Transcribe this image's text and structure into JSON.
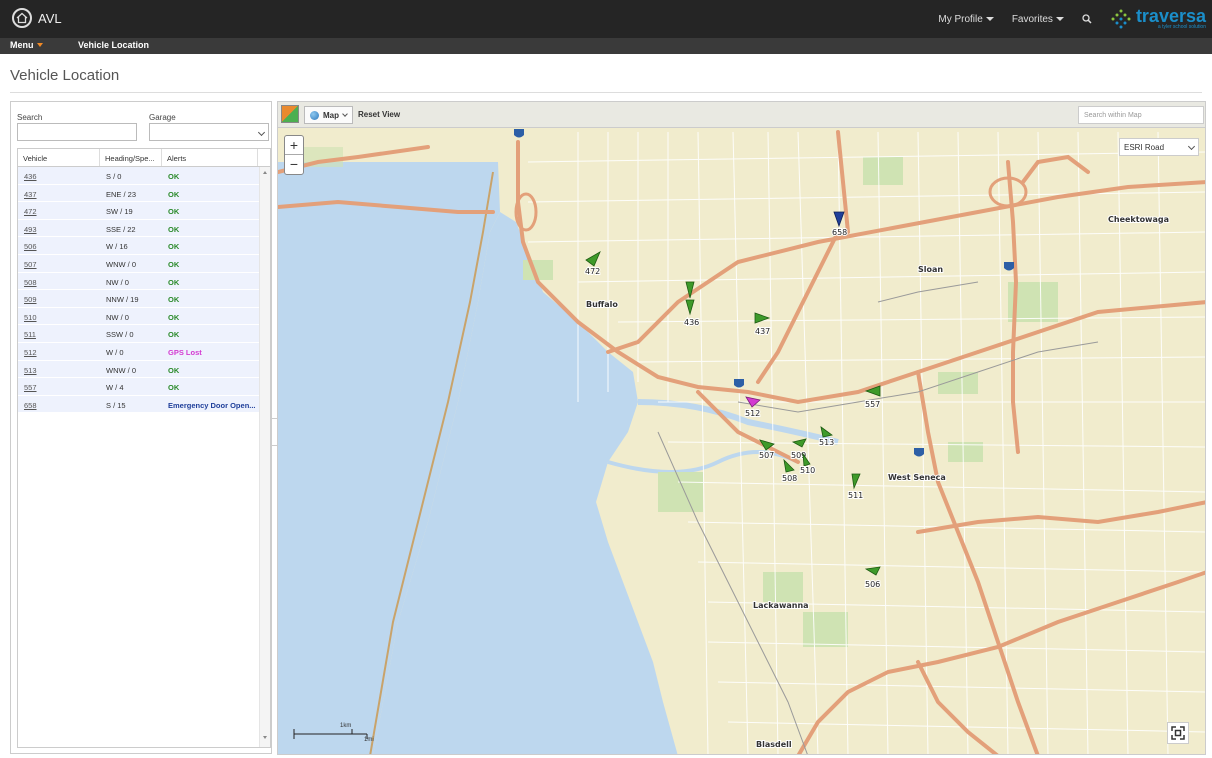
{
  "app": {
    "title": "AVL",
    "profile_label": "My Profile",
    "favorites_label": "Favorites",
    "brand_name": "traversa",
    "brand_sub": "a tyler school solution"
  },
  "nav": {
    "menu_label": "Menu",
    "breadcrumb": "Vehicle Location"
  },
  "page": {
    "title": "Vehicle Location"
  },
  "filters": {
    "search_label": "Search",
    "search_value": "",
    "garage_label": "Garage",
    "garage_value": ""
  },
  "table": {
    "columns": [
      "Vehicle",
      "Heading/Spe...",
      "Alerts"
    ],
    "rows": [
      {
        "vehicle": "436",
        "heading": "S / 0",
        "alert": "OK",
        "status": "ok"
      },
      {
        "vehicle": "437",
        "heading": "ENE / 23",
        "alert": "OK",
        "status": "ok"
      },
      {
        "vehicle": "472",
        "heading": "SW / 19",
        "alert": "OK",
        "status": "ok"
      },
      {
        "vehicle": "493",
        "heading": "SSE / 22",
        "alert": "OK",
        "status": "ok"
      },
      {
        "vehicle": "506",
        "heading": "W / 16",
        "alert": "OK",
        "status": "ok"
      },
      {
        "vehicle": "507",
        "heading": "WNW / 0",
        "alert": "OK",
        "status": "ok"
      },
      {
        "vehicle": "508",
        "heading": "NW / 0",
        "alert": "OK",
        "status": "ok"
      },
      {
        "vehicle": "509",
        "heading": "NNW / 19",
        "alert": "OK",
        "status": "ok"
      },
      {
        "vehicle": "510",
        "heading": "NW / 0",
        "alert": "OK",
        "status": "ok"
      },
      {
        "vehicle": "511",
        "heading": "SSW / 0",
        "alert": "OK",
        "status": "ok"
      },
      {
        "vehicle": "512",
        "heading": "W / 0",
        "alert": "GPS Lost",
        "status": "gps"
      },
      {
        "vehicle": "513",
        "heading": "WNW / 0",
        "alert": "OK",
        "status": "ok"
      },
      {
        "vehicle": "557",
        "heading": "W / 4",
        "alert": "OK",
        "status": "ok"
      },
      {
        "vehicle": "658",
        "heading": "S / 15",
        "alert": "Emergency Door Open...",
        "status": "emg"
      }
    ]
  },
  "map": {
    "basemap_button": "Map",
    "reset_label": "Reset View",
    "search_placeholder": "Search within Map",
    "basemap_select": "ESRI Road",
    "zoom_in": "+",
    "zoom_out": "−",
    "scale_km": "1km",
    "scale_mi": "1mi",
    "places": [
      "Buffalo",
      "Sloan",
      "Cheektowaga",
      "West Seneca",
      "Lackawanna",
      "Blasdell"
    ],
    "vehicle_markers": [
      "472",
      "436",
      "437",
      "658",
      "557",
      "512",
      "513",
      "507",
      "509",
      "510",
      "508",
      "511",
      "506"
    ],
    "colors": {
      "ok_marker": "#3e9a2a",
      "gps_marker": "#d33ad1",
      "emergency_marker": "#1f3f9a",
      "water": "#bdd7ee",
      "land": "#f1eccd",
      "highway": "#e3a07a"
    }
  },
  "icons": {
    "home": "home-icon",
    "search": "search-icon",
    "fullscreen": "fullscreen-icon",
    "layer": "layer-icon",
    "globe": "globe-icon"
  }
}
